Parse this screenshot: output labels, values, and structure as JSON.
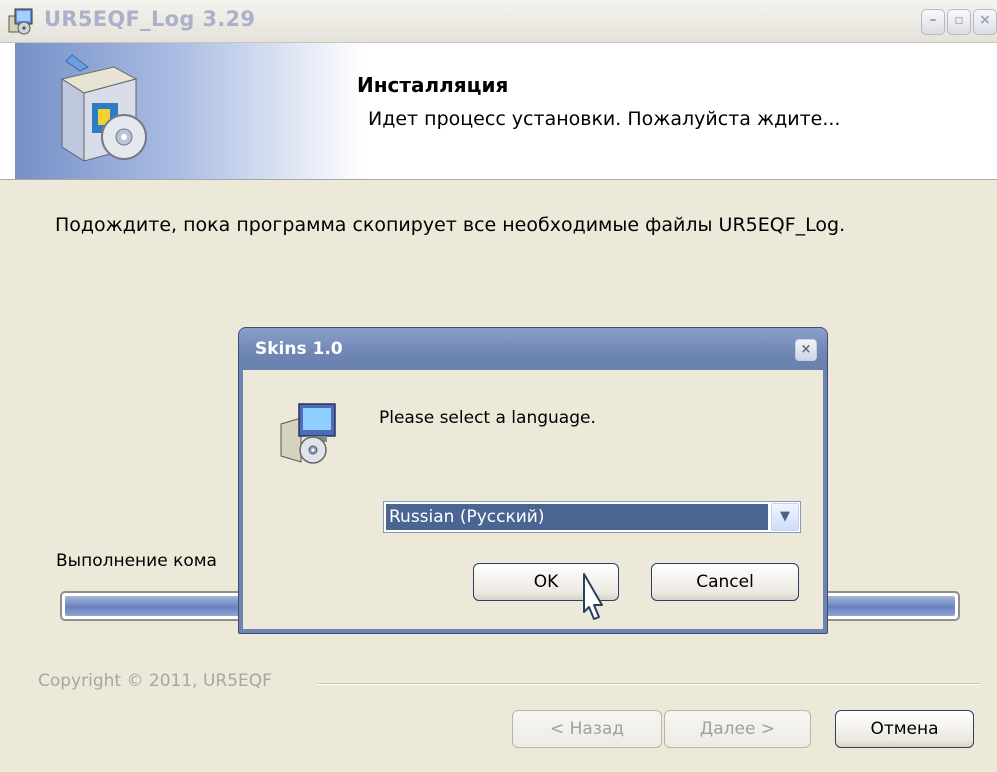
{
  "main_window": {
    "title": "UR5EQF_Log 3.29",
    "header": {
      "title": "Инсталляция",
      "subtitle": "Идет процесс установки. Пожалуйста ждите..."
    },
    "body_text": "Подождите, пока программа скопирует все необходимые файлы UR5EQF_Log.",
    "status_label": "Выполнение кома",
    "progress": 1.0,
    "copyright": "Copyright © 2011, UR5EQF",
    "buttons": {
      "back": "< Назад",
      "next": "Далее >",
      "cancel": "Отмена"
    }
  },
  "dialog": {
    "title": "Skins 1.0",
    "message": "Please select a language.",
    "language_selected": "Russian (Русский)",
    "ok": "OK",
    "cancel": "Cancel"
  },
  "icons": [
    "installer-icon",
    "software-box-icon",
    "minimize-icon",
    "maximize-icon",
    "close-icon",
    "chevron-down-icon",
    "mouse-cursor-icon"
  ]
}
